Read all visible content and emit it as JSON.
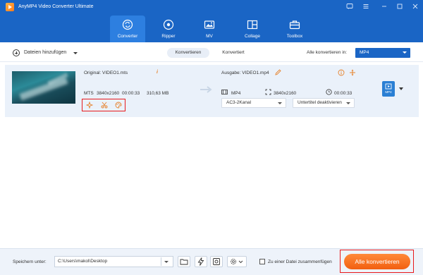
{
  "window": {
    "title": "AnyMP4 Video Converter Ultimate"
  },
  "tabs": [
    {
      "label": "Converter",
      "icon": "converter-icon",
      "active": true
    },
    {
      "label": "Ripper",
      "icon": "disc-icon",
      "active": false
    },
    {
      "label": "MV",
      "icon": "mv-icon",
      "active": false
    },
    {
      "label": "Collage",
      "icon": "collage-icon",
      "active": false
    },
    {
      "label": "Toolbox",
      "icon": "toolbox-icon",
      "active": false
    }
  ],
  "toolbar": {
    "add_files_label": "Dateien hinzufügen",
    "mode_active": "Konvertieren",
    "mode_inactive": "Konvertiert",
    "convert_all_in_label": "Alle konvertieren in:",
    "format_value": "MP4"
  },
  "file": {
    "source_name": "Original: VIDEO1.mts",
    "source_format": "MTS",
    "source_resolution": "3840x2160",
    "source_duration": "00:00:33",
    "source_size": "310,63 MB",
    "output_name": "Ausgabe: VIDEO1.mp4",
    "output_format": "MP4",
    "output_resolution": "3840x2160",
    "output_duration": "00:00:33",
    "audio_track": "AC3-2Kanal",
    "subtitle": "Untertitel deaktivieren",
    "format_badge": "MP4"
  },
  "bottom": {
    "save_label": "Speichern unter:",
    "save_path": "C:\\Users\\makol\\Desktop",
    "merge_label": "Zu einer Datei zusammenfügen",
    "convert_all_button": "Alle konvertieren"
  },
  "colors": {
    "header_blue": "#1a65c5",
    "accent_orange": "#f25f10",
    "highlight_red": "#e8191c"
  }
}
